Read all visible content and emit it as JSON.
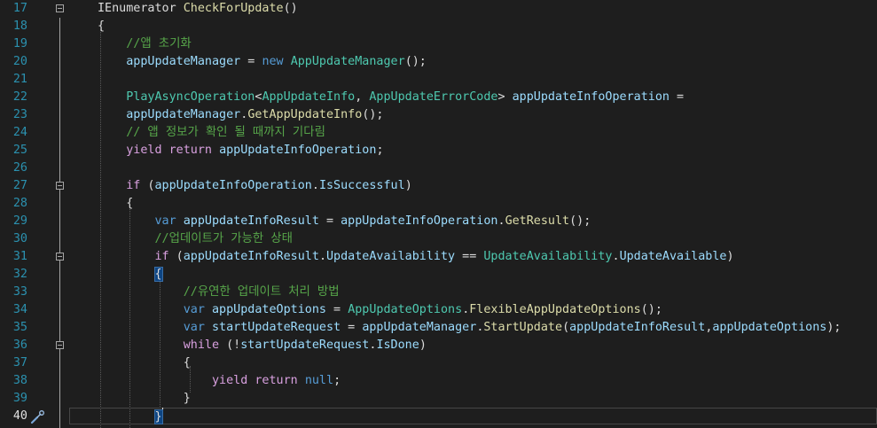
{
  "editor": {
    "active_line": 40,
    "lines": [
      {
        "num": "17",
        "tokens": [
          {
            "t": "IEnumerator ",
            "c": "pl"
          },
          {
            "t": "CheckForUpdate",
            "c": "fn"
          },
          {
            "t": "()",
            "c": "pl"
          }
        ]
      },
      {
        "num": "18",
        "tokens": [
          {
            "t": "{",
            "c": "pl"
          }
        ]
      },
      {
        "num": "19",
        "tokens": [
          {
            "t": "    //앱 초기화",
            "c": "cm"
          }
        ]
      },
      {
        "num": "20",
        "tokens": [
          {
            "t": "    ",
            "c": "pl"
          },
          {
            "t": "appUpdateManager",
            "c": "var"
          },
          {
            "t": " = ",
            "c": "pl"
          },
          {
            "t": "new",
            "c": "kw"
          },
          {
            "t": " ",
            "c": "pl"
          },
          {
            "t": "AppUpdateManager",
            "c": "ty"
          },
          {
            "t": "();",
            "c": "pl"
          }
        ]
      },
      {
        "num": "21",
        "tokens": []
      },
      {
        "num": "22",
        "tokens": [
          {
            "t": "    ",
            "c": "pl"
          },
          {
            "t": "PlayAsyncOperation",
            "c": "ty"
          },
          {
            "t": "<",
            "c": "pl"
          },
          {
            "t": "AppUpdateInfo",
            "c": "ty"
          },
          {
            "t": ", ",
            "c": "pl"
          },
          {
            "t": "AppUpdateErrorCode",
            "c": "ty"
          },
          {
            "t": "> ",
            "c": "pl"
          },
          {
            "t": "appUpdateInfoOperation",
            "c": "var"
          },
          {
            "t": " =",
            "c": "pl"
          }
        ]
      },
      {
        "num": "23",
        "tokens": [
          {
            "t": "    ",
            "c": "pl"
          },
          {
            "t": "appUpdateManager",
            "c": "var"
          },
          {
            "t": ".",
            "c": "pl"
          },
          {
            "t": "GetAppUpdateInfo",
            "c": "fn"
          },
          {
            "t": "();",
            "c": "pl"
          }
        ]
      },
      {
        "num": "24",
        "tokens": [
          {
            "t": "    // 앱 정보가 확인 될 때까지 기다림",
            "c": "cm"
          }
        ]
      },
      {
        "num": "25",
        "tokens": [
          {
            "t": "    ",
            "c": "pl"
          },
          {
            "t": "yield return",
            "c": "ctl"
          },
          {
            "t": " ",
            "c": "pl"
          },
          {
            "t": "appUpdateInfoOperation",
            "c": "var"
          },
          {
            "t": ";",
            "c": "pl"
          }
        ]
      },
      {
        "num": "26",
        "tokens": []
      },
      {
        "num": "27",
        "tokens": [
          {
            "t": "    ",
            "c": "pl"
          },
          {
            "t": "if",
            "c": "ctl"
          },
          {
            "t": " (",
            "c": "pl"
          },
          {
            "t": "appUpdateInfoOperation",
            "c": "var"
          },
          {
            "t": ".",
            "c": "pl"
          },
          {
            "t": "IsSuccessful",
            "c": "var"
          },
          {
            "t": ")",
            "c": "pl"
          }
        ]
      },
      {
        "num": "28",
        "tokens": [
          {
            "t": "    {",
            "c": "pl"
          }
        ]
      },
      {
        "num": "29",
        "tokens": [
          {
            "t": "        ",
            "c": "pl"
          },
          {
            "t": "var",
            "c": "kw"
          },
          {
            "t": " ",
            "c": "pl"
          },
          {
            "t": "appUpdateInfoResult",
            "c": "var"
          },
          {
            "t": " = ",
            "c": "pl"
          },
          {
            "t": "appUpdateInfoOperation",
            "c": "var"
          },
          {
            "t": ".",
            "c": "pl"
          },
          {
            "t": "GetResult",
            "c": "fn"
          },
          {
            "t": "();",
            "c": "pl"
          }
        ]
      },
      {
        "num": "30",
        "tokens": [
          {
            "t": "        //업데이트가 가능한 상태",
            "c": "cm"
          }
        ]
      },
      {
        "num": "31",
        "tokens": [
          {
            "t": "        ",
            "c": "pl"
          },
          {
            "t": "if",
            "c": "ctl"
          },
          {
            "t": " (",
            "c": "pl"
          },
          {
            "t": "appUpdateInfoResult",
            "c": "var"
          },
          {
            "t": ".",
            "c": "pl"
          },
          {
            "t": "UpdateAvailability",
            "c": "var"
          },
          {
            "t": " == ",
            "c": "pl"
          },
          {
            "t": "UpdateAvailability",
            "c": "ty"
          },
          {
            "t": ".",
            "c": "pl"
          },
          {
            "t": "UpdateAvailable",
            "c": "var"
          },
          {
            "t": ")",
            "c": "pl"
          }
        ]
      },
      {
        "num": "32",
        "tokens": [
          {
            "t": "        ",
            "c": "pl"
          },
          {
            "t": "{",
            "c": "pl",
            "hl": true
          }
        ]
      },
      {
        "num": "33",
        "tokens": [
          {
            "t": "            //유연한 업데이트 처리 방법",
            "c": "cm"
          }
        ]
      },
      {
        "num": "34",
        "tokens": [
          {
            "t": "            ",
            "c": "pl"
          },
          {
            "t": "var",
            "c": "kw"
          },
          {
            "t": " ",
            "c": "pl"
          },
          {
            "t": "appUpdateOptions",
            "c": "var"
          },
          {
            "t": " = ",
            "c": "pl"
          },
          {
            "t": "AppUpdateOptions",
            "c": "ty"
          },
          {
            "t": ".",
            "c": "pl"
          },
          {
            "t": "FlexibleAppUpdateOptions",
            "c": "fn"
          },
          {
            "t": "();",
            "c": "pl"
          }
        ]
      },
      {
        "num": "35",
        "tokens": [
          {
            "t": "            ",
            "c": "pl"
          },
          {
            "t": "var",
            "c": "kw"
          },
          {
            "t": " ",
            "c": "pl"
          },
          {
            "t": "startUpdateRequest",
            "c": "var"
          },
          {
            "t": " = ",
            "c": "pl"
          },
          {
            "t": "appUpdateManager",
            "c": "var"
          },
          {
            "t": ".",
            "c": "pl"
          },
          {
            "t": "StartUpdate",
            "c": "fn"
          },
          {
            "t": "(",
            "c": "pl"
          },
          {
            "t": "appUpdateInfoResult",
            "c": "var"
          },
          {
            "t": ",",
            "c": "pl"
          },
          {
            "t": "appUpdateOptions",
            "c": "var"
          },
          {
            "t": ");",
            "c": "pl"
          }
        ]
      },
      {
        "num": "36",
        "tokens": [
          {
            "t": "            ",
            "c": "pl"
          },
          {
            "t": "while",
            "c": "ctl"
          },
          {
            "t": " (!",
            "c": "pl"
          },
          {
            "t": "startUpdateRequest",
            "c": "var"
          },
          {
            "t": ".",
            "c": "pl"
          },
          {
            "t": "IsDone",
            "c": "var"
          },
          {
            "t": ")",
            "c": "pl"
          }
        ]
      },
      {
        "num": "37",
        "tokens": [
          {
            "t": "            {",
            "c": "pl"
          }
        ]
      },
      {
        "num": "38",
        "tokens": [
          {
            "t": "                ",
            "c": "pl"
          },
          {
            "t": "yield return",
            "c": "ctl"
          },
          {
            "t": " ",
            "c": "pl"
          },
          {
            "t": "null",
            "c": "kw"
          },
          {
            "t": ";",
            "c": "pl"
          }
        ]
      },
      {
        "num": "39",
        "tokens": [
          {
            "t": "            }",
            "c": "pl"
          }
        ]
      },
      {
        "num": "40",
        "tokens": [
          {
            "t": "        ",
            "c": "pl"
          },
          {
            "t": "}",
            "c": "pl",
            "hl": true,
            "cursor": true
          }
        ]
      }
    ],
    "fold_markers": [
      "17",
      "27",
      "31",
      "36"
    ],
    "margin_icon": "quick-action-screwdriver-icon"
  },
  "colors": {
    "background": "#1e1e1e",
    "line_number": "#2b91af",
    "keyword": "#569cd6",
    "control_keyword": "#d8a0df",
    "type": "#4ec9b0",
    "method": "#dcdcaa",
    "identifier": "#9cdcfe",
    "comment": "#57a64a",
    "brace_highlight": "#0e4583"
  }
}
